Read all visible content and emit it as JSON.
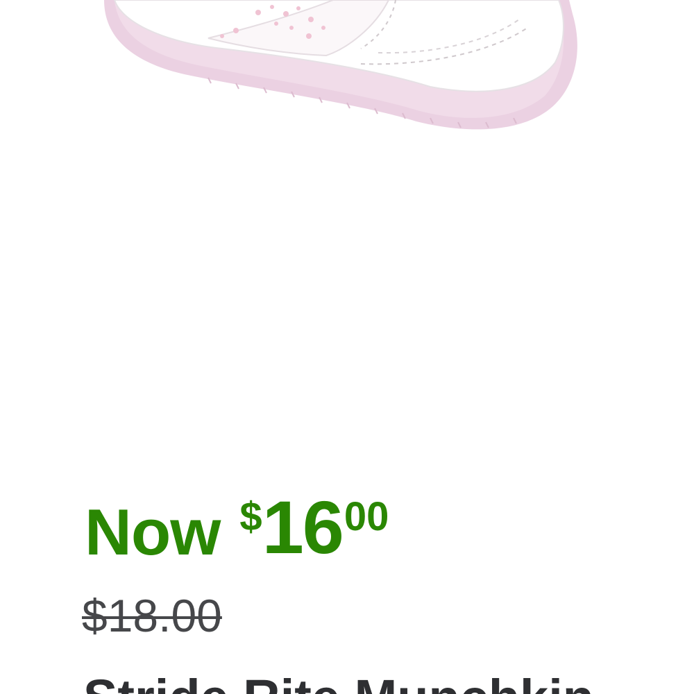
{
  "product": {
    "image_alt": "White and pink toddler sneaker",
    "title": "Stride Rite Munchkin"
  },
  "price": {
    "now_label": "Now",
    "currency": "$",
    "dollars": "16",
    "cents": "00",
    "was": "$18.00"
  },
  "colors": {
    "price_green": "#2a8703",
    "was_gray": "#46474a",
    "title_dark": "#2e2f32",
    "sole_pink": "#e9cde0"
  }
}
